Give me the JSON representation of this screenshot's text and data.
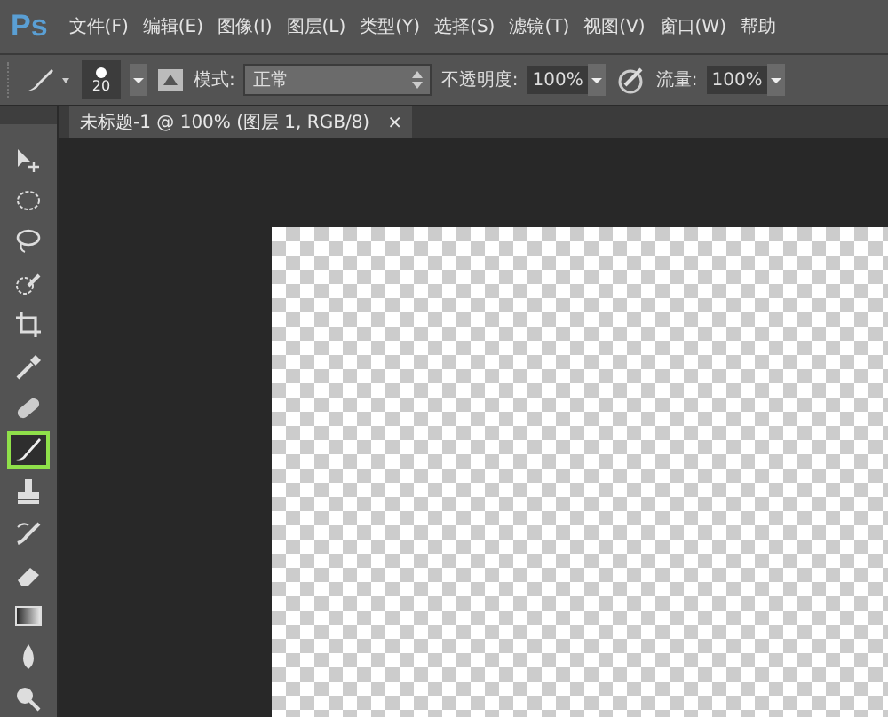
{
  "app": {
    "logo": "Ps"
  },
  "menu": [
    "文件(F)",
    "编辑(E)",
    "图像(I)",
    "图层(L)",
    "类型(Y)",
    "选择(S)",
    "滤镜(T)",
    "视图(V)",
    "窗口(W)",
    "帮助"
  ],
  "options_bar": {
    "brush_size": "20",
    "mode_label": "模式:",
    "mode_value": "正常",
    "opacity_label": "不透明度:",
    "opacity_value": "100%",
    "flow_label": "流量:",
    "flow_value": "100%"
  },
  "document_tab": {
    "title": "未标题-1 @ 100% (图层 1, RGB/8)",
    "close": "×"
  },
  "tools": [
    {
      "kind": "move",
      "selected": false
    },
    {
      "kind": "marquee",
      "selected": false
    },
    {
      "kind": "lasso",
      "selected": false
    },
    {
      "kind": "quick-select",
      "selected": false
    },
    {
      "kind": "crop",
      "selected": false
    },
    {
      "kind": "eyedropper",
      "selected": false
    },
    {
      "kind": "healing",
      "selected": false
    },
    {
      "kind": "brush",
      "selected": true
    },
    {
      "kind": "stamp",
      "selected": false
    },
    {
      "kind": "history-brush",
      "selected": false
    },
    {
      "kind": "eraser",
      "selected": false
    },
    {
      "kind": "gradient",
      "selected": false
    },
    {
      "kind": "blur",
      "selected": false
    },
    {
      "kind": "dodge",
      "selected": false
    }
  ]
}
